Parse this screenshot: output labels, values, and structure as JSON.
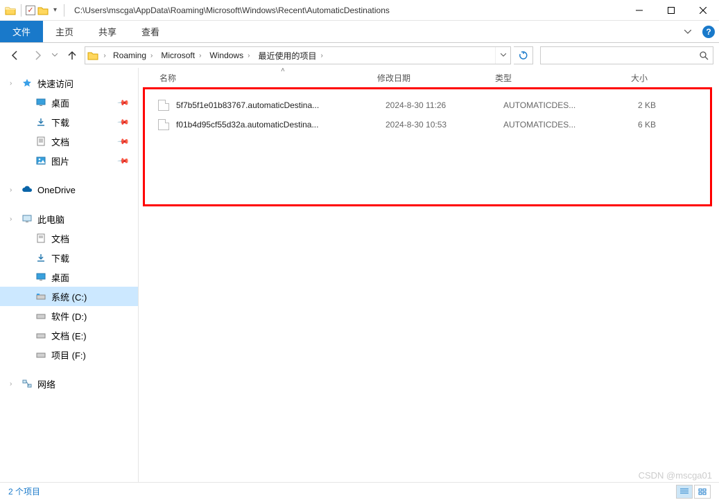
{
  "titlebar": {
    "path": "C:\\Users\\mscga\\AppData\\Roaming\\Microsoft\\Windows\\Recent\\AutomaticDestinations"
  },
  "ribbon": {
    "file": "文件",
    "tabs": [
      "主页",
      "共享",
      "查看"
    ]
  },
  "breadcrumbs": [
    "Roaming",
    "Microsoft",
    "Windows",
    "最近使用的项目"
  ],
  "search": {
    "placeholder": ""
  },
  "columns": {
    "name": "名称",
    "date": "修改日期",
    "type": "类型",
    "size": "大小"
  },
  "files": [
    {
      "name": "5f7b5f1e01b83767.automaticDestina...",
      "date": "2024-8-30 11:26",
      "type": "AUTOMATICDES...",
      "size": "2 KB"
    },
    {
      "name": "f01b4d95cf55d32a.automaticDestina...",
      "date": "2024-8-30 10:53",
      "type": "AUTOMATICDES...",
      "size": "6 KB"
    }
  ],
  "sidebar": {
    "quick": {
      "label": "快速访问",
      "items": [
        "桌面",
        "下载",
        "文档",
        "图片"
      ]
    },
    "onedrive": "OneDrive",
    "thispc": {
      "label": "此电脑",
      "items": [
        "文档",
        "下载",
        "桌面",
        "系统 (C:)",
        "软件 (D:)",
        "文档 (E:)",
        "项目 (F:)"
      ],
      "selected": 3
    },
    "network": "网络"
  },
  "status": {
    "count": "2 个项目"
  },
  "watermark": "CSDN @mscga01"
}
